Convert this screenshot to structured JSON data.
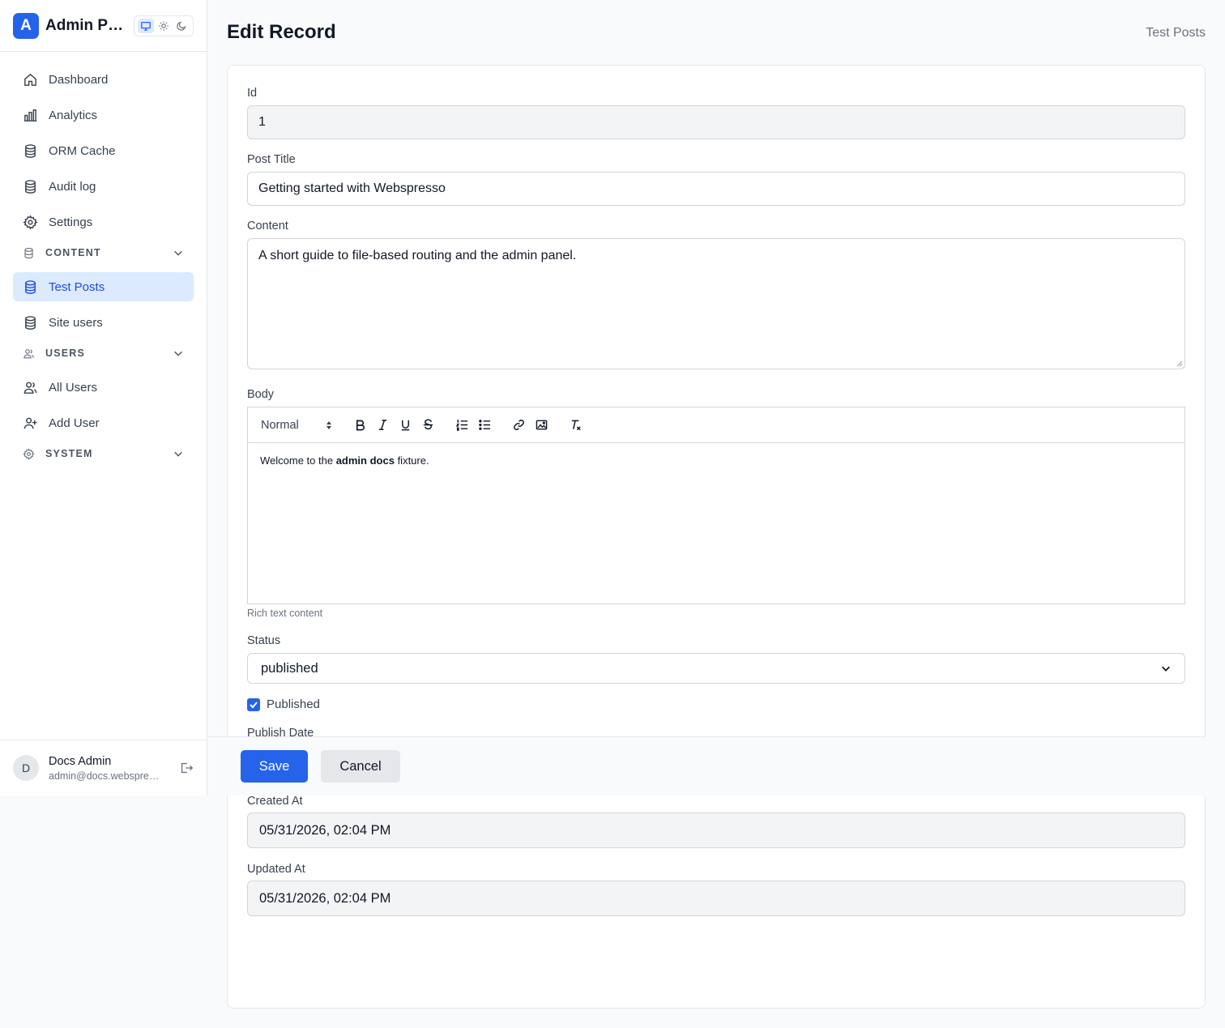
{
  "app": {
    "logo_letter": "A",
    "title": "Admin Panel"
  },
  "sidebar": {
    "items_top": [
      {
        "label": "Dashboard",
        "icon": "home-icon"
      },
      {
        "label": "Analytics",
        "icon": "bar-chart-icon"
      },
      {
        "label": "ORM Cache",
        "icon": "database-icon"
      },
      {
        "label": "Audit log",
        "icon": "database-icon"
      },
      {
        "label": "Settings",
        "icon": "gear-icon"
      }
    ],
    "sections": {
      "content": {
        "label": "CONTENT",
        "items": [
          {
            "label": "Test Posts",
            "icon": "database-icon",
            "active": true
          },
          {
            "label": "Site users",
            "icon": "database-icon"
          }
        ]
      },
      "users": {
        "label": "USERS",
        "items": [
          {
            "label": "All Users",
            "icon": "users-icon"
          },
          {
            "label": "Add User",
            "icon": "user-plus-icon"
          }
        ]
      },
      "system": {
        "label": "SYSTEM"
      }
    },
    "footer": {
      "avatar_letter": "D",
      "name": "Docs Admin",
      "email": "admin@docs.webspresso.dev"
    }
  },
  "header": {
    "title": "Edit Record",
    "breadcrumb": "Test Posts"
  },
  "form": {
    "id": {
      "label": "Id",
      "value": "1"
    },
    "post_title": {
      "label": "Post Title",
      "value": "Getting started with Webspresso"
    },
    "content": {
      "label": "Content",
      "value": "A short guide to file-based routing and the admin panel."
    },
    "body": {
      "label": "Body",
      "format": "Normal",
      "text_before": "Welcome to the ",
      "text_bold": "admin docs",
      "text_after": " fixture.",
      "help": "Rich text content"
    },
    "status": {
      "label": "Status",
      "value": "published"
    },
    "published": {
      "label": "Published",
      "checked": true
    },
    "publish_date": {
      "label": "Publish Date"
    },
    "created_at": {
      "label": "Created At",
      "value": "05/31/2026, 02:04 PM"
    },
    "updated_at": {
      "label": "Updated At",
      "value": "05/31/2026, 02:04 PM"
    }
  },
  "actions": {
    "save": "Save",
    "cancel": "Cancel"
  },
  "colors": {
    "accent": "#2563eb",
    "active_bg": "#dbeafe"
  }
}
